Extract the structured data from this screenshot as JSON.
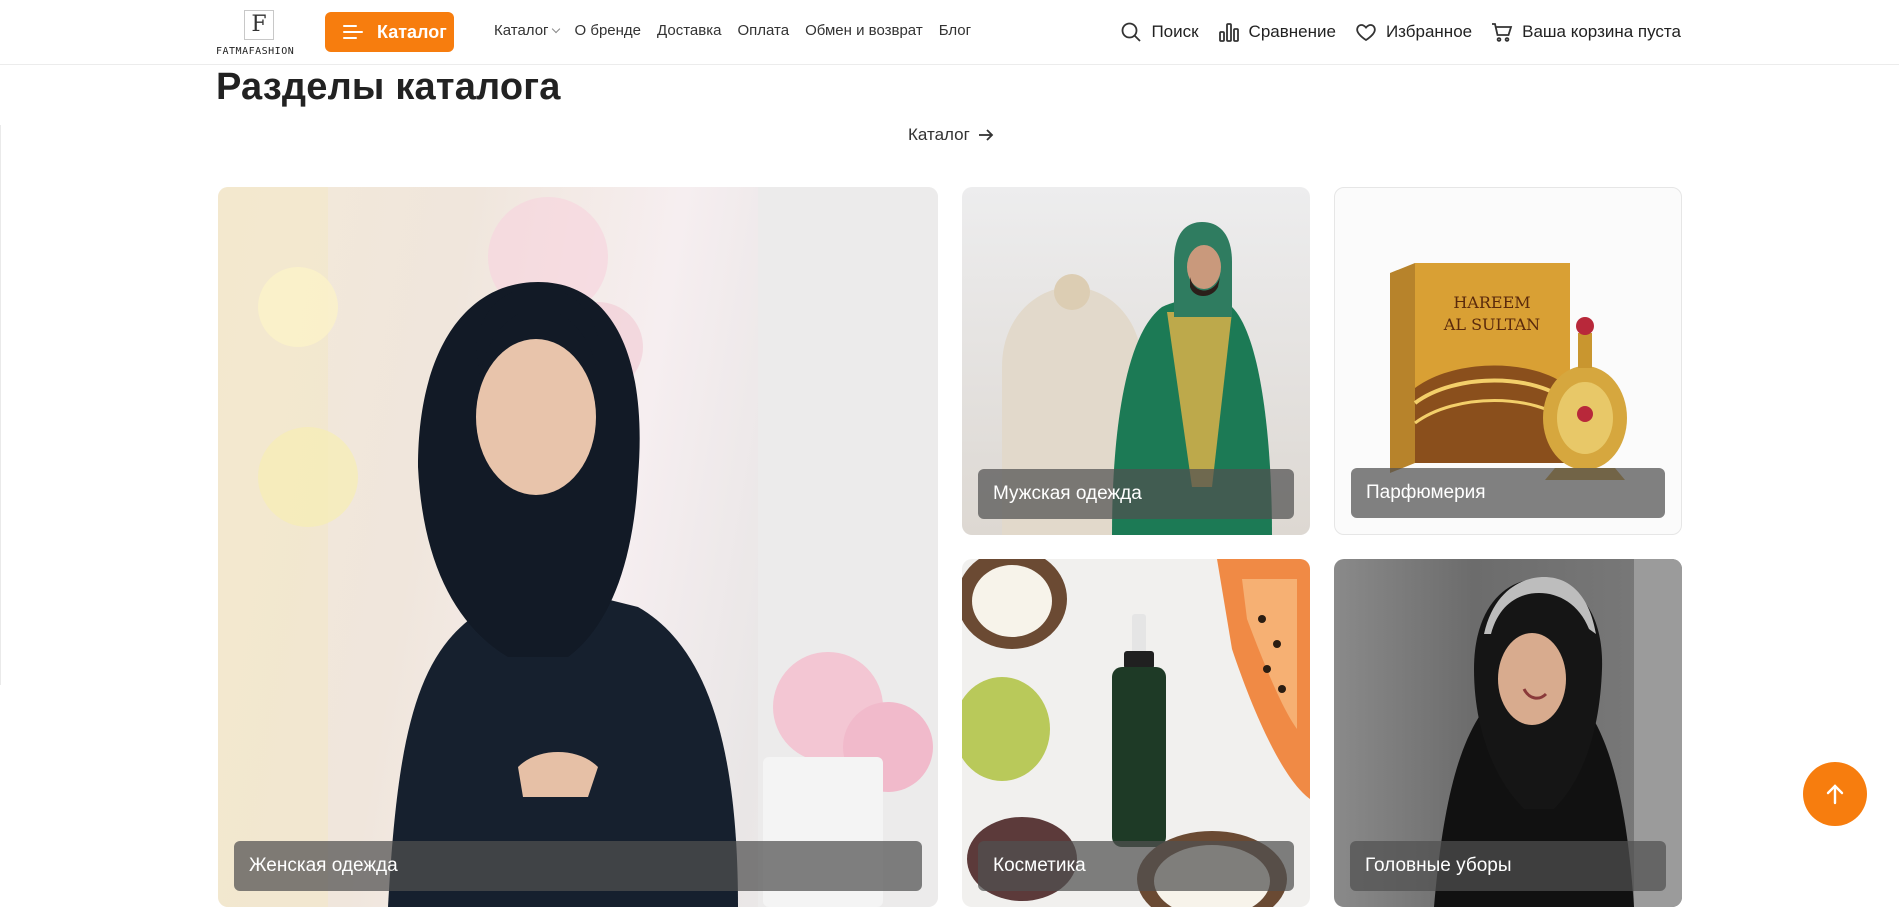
{
  "header": {
    "logo_text": "FATMAFASHION",
    "logo_mark": "F",
    "catalog_button": "Каталог",
    "nav": [
      {
        "label": "Каталог",
        "has_dropdown": true
      },
      {
        "label": "О бренде"
      },
      {
        "label": "Доставка"
      },
      {
        "label": "Оплата"
      },
      {
        "label": "Обмен и возврат"
      },
      {
        "label": "Блог"
      }
    ],
    "actions": {
      "search": "Поиск",
      "compare": "Сравнение",
      "favorites": "Избранное",
      "cart": "Ваша корзина пуста"
    }
  },
  "main": {
    "title": "Разделы каталога",
    "catalog_link": "Каталог",
    "categories": [
      {
        "label": "Женская одежда"
      },
      {
        "label": "Мужская одежда"
      },
      {
        "label": "Парфюмерия"
      },
      {
        "label": "Косметика"
      },
      {
        "label": "Головные уборы"
      }
    ],
    "perfume_box_text": [
      "HAREEM",
      "AL SULTAN"
    ]
  },
  "colors": {
    "accent": "#f77d0e",
    "label_bg": "rgba(80,80,80,0.72)"
  },
  "icons": {
    "scroll_top": "arrow-up-icon"
  }
}
